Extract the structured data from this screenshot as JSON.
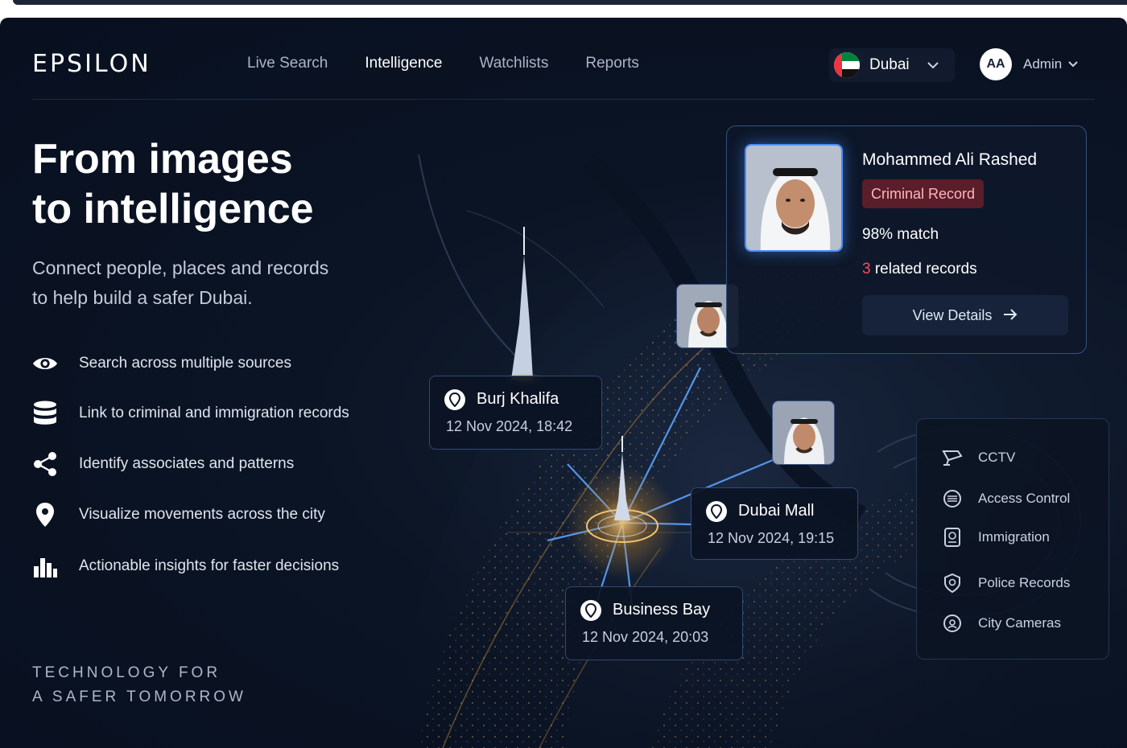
{
  "app": {
    "logo": "EPSILON",
    "nav": [
      "Live Search",
      "Intelligence",
      "Watchlists",
      "Reports"
    ],
    "active_nav": "Intelligence",
    "city": "Dubai",
    "user_initials": "AA",
    "user_name": "Admin"
  },
  "hero": {
    "title_line1": "From images",
    "title_line2": "to intelligence",
    "subtitle_line1": "Connect people, places and records",
    "subtitle_line2": "to help build a safer Dubai.",
    "features": [
      {
        "icon": "eye-icon",
        "text": "Search across multiple sources"
      },
      {
        "icon": "database-icon",
        "text": "Link to criminal and immigration records"
      },
      {
        "icon": "share-icon",
        "text": "Identify associates and patterns"
      },
      {
        "icon": "location-pin-icon",
        "text": "Visualize movements across the city"
      },
      {
        "icon": "bar-chart-icon",
        "text": "Actionable insights for faster decisions"
      }
    ],
    "tagline_line1": "TECHNOLOGY FOR",
    "tagline_line2": "A SAFER TOMORROW"
  },
  "profile": {
    "name": "Mohammed Ali Rashed",
    "badge": "Criminal Record",
    "match": "98% match",
    "related_count": "3",
    "related_text": " related records",
    "button": "View Details"
  },
  "locations": [
    {
      "name": "Burj Khalifa",
      "time": "12 Nov 2024, 18:42"
    },
    {
      "name": "Dubai Mall",
      "time": "12 Nov 2024, 19:15"
    },
    {
      "name": "Business Bay",
      "time": "12 Nov 2024, 20:03"
    }
  ],
  "sources": [
    {
      "icon": "cctv-icon",
      "label": "CCTV"
    },
    {
      "icon": "access-control-icon",
      "label": "Access Control"
    },
    {
      "icon": "immigration-icon",
      "label": "Immigration"
    },
    {
      "icon": "police-badge-icon",
      "label": "Police Records"
    },
    {
      "icon": "city-camera-icon",
      "label": "City Cameras"
    }
  ],
  "colors": {
    "background": "#0b1424",
    "accent": "#4d8cff",
    "badge_bg": "#5a1d2a",
    "badge_text": "#ffb5bf",
    "highlight_red": "#ff4b5c"
  }
}
